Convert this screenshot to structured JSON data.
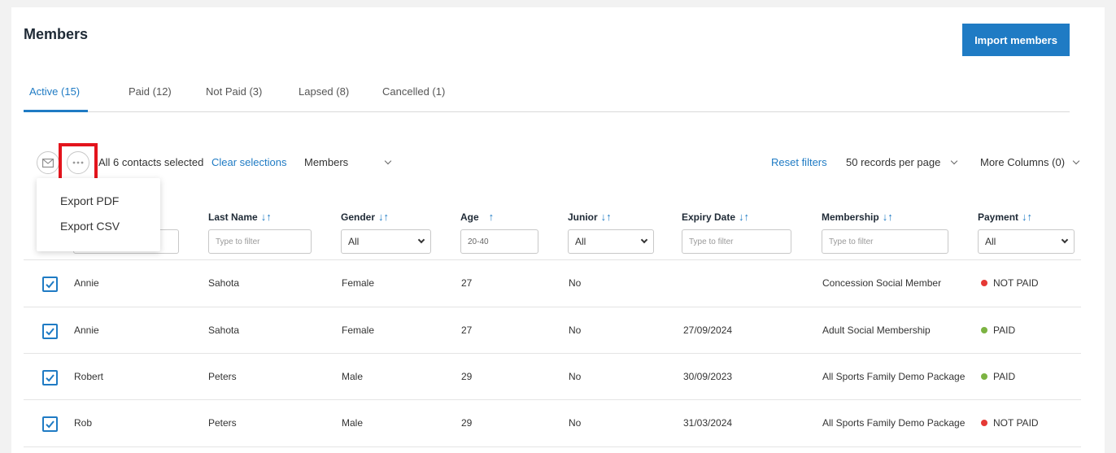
{
  "page": {
    "title": "Members",
    "import_label": "Import members"
  },
  "tabs": [
    {
      "label": "Active (15)"
    },
    {
      "label": "Paid (12)"
    },
    {
      "label": "Not Paid (3)"
    },
    {
      "label": "Lapsed (8)"
    },
    {
      "label": "Cancelled (1)"
    }
  ],
  "toolbar": {
    "selected_text": "All 6 contacts selected",
    "clear_label": "Clear selections",
    "members_dropdown": "Members",
    "reset_label": "Reset filters",
    "per_page": "50 records per page",
    "more_columns": "More Columns (0)"
  },
  "menu": {
    "items": [
      "Export PDF",
      "Export CSV"
    ]
  },
  "columns": {
    "last_name": "Last Name",
    "gender": "Gender",
    "age": "Age",
    "junior": "Junior",
    "expiry": "Expiry Date",
    "membership": "Membership",
    "payment": "Payment"
  },
  "filters": {
    "last_name_placeholder": "Type to filter",
    "gender_value": "All",
    "age_value": "20-40",
    "junior_value": "All",
    "expiry_placeholder": "Type to filter",
    "membership_placeholder": "Type to filter",
    "payment_value": "All"
  },
  "status_colors": {
    "paid": "#7cb342",
    "not_paid": "#e53935",
    "accent": "#1f7bc4"
  },
  "rows": [
    {
      "first": "Annie",
      "last": "Sahota",
      "gender": "Female",
      "age": "27",
      "junior": "No",
      "expiry": "",
      "membership": "Concession Social Member",
      "payment": "NOT PAID"
    },
    {
      "first": "Annie",
      "last": "Sahota",
      "gender": "Female",
      "age": "27",
      "junior": "No",
      "expiry": "27/09/2024",
      "membership": "Adult Social Membership",
      "payment": "PAID"
    },
    {
      "first": "Robert",
      "last": "Peters",
      "gender": "Male",
      "age": "29",
      "junior": "No",
      "expiry": "30/09/2023",
      "membership": "All Sports Family Demo Package",
      "payment": "PAID"
    },
    {
      "first": "Rob",
      "last": "Peters",
      "gender": "Male",
      "age": "29",
      "junior": "No",
      "expiry": "31/03/2024",
      "membership": "All Sports Family Demo Package",
      "payment": "NOT PAID"
    }
  ]
}
